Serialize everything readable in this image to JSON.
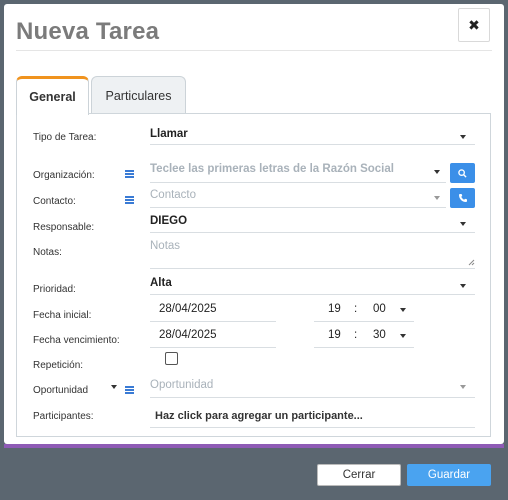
{
  "modal": {
    "title": "Nueva Tarea",
    "close_symbol": "✖"
  },
  "tabs": [
    {
      "label": "General",
      "active": true
    },
    {
      "label": "Particulares",
      "active": false
    }
  ],
  "form": {
    "tipo_label": "Tipo de Tarea:",
    "tipo_value": "Llamar",
    "organizacion_label": "Organización:",
    "organizacion_placeholder": "Teclee las primeras letras de la Razón Social",
    "contacto_label": "Contacto:",
    "contacto_placeholder": "Contacto",
    "responsable_label": "Responsable:",
    "responsable_value": "DIEGO",
    "notas_label": "Notas:",
    "notas_placeholder": "Notas",
    "prioridad_label": "Prioridad:",
    "prioridad_value": "Alta",
    "fecha_inicial_label": "Fecha inicial:",
    "fecha_inicial_date": "28/04/2025",
    "fecha_inicial_hour": "19",
    "fecha_inicial_minute": "00",
    "fecha_venc_label": "Fecha vencimiento:",
    "fecha_venc_date": "28/04/2025",
    "fecha_venc_hour": "19",
    "fecha_venc_minute": "30",
    "time_sep": ":",
    "repeticion_label": "Repetición:",
    "repeticion_checked": false,
    "oportunidad_label": "Oportunidad",
    "oportunidad_placeholder": "Oportunidad",
    "participantes_label": "Participantes:",
    "participantes_prompt": "Haz click para agregar un participante..."
  },
  "footer": {
    "cancel_label": "Cerrar",
    "save_label": "Guardar"
  },
  "colors": {
    "accent": "#f0931e",
    "primary": "#3b8fe8",
    "save": "#4aa3f0",
    "stripe": "#8e5bb5",
    "backdrop": "#5b6670"
  },
  "icons": {
    "org": "list-icon",
    "search": "search-icon",
    "phone": "phone-icon",
    "chevron": "chevron-down-icon"
  }
}
